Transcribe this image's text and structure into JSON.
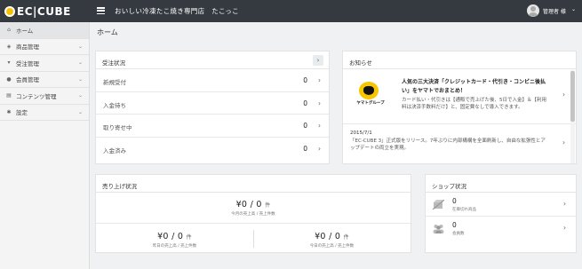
{
  "header": {
    "logo_text": "EC|CUBE",
    "shop_name": "おいしい冷凍たこ焼き専門店　たこっこ",
    "user_name": "管理者 様",
    "user_chevron": "⌄"
  },
  "sidebar": {
    "items": [
      {
        "label": "ホーム",
        "icon": "home-icon",
        "glyph": "⌂",
        "chevron": ""
      },
      {
        "label": "商品管理",
        "icon": "tag-icon",
        "glyph": "◈",
        "chevron": "⌄"
      },
      {
        "label": "受注管理",
        "icon": "cart-icon",
        "glyph": "▾",
        "chevron": "⌄"
      },
      {
        "label": "会員管理",
        "icon": "user-icon",
        "glyph": "●",
        "chevron": "⌄"
      },
      {
        "label": "コンテンツ管理",
        "icon": "file-icon",
        "glyph": "▤",
        "chevron": "⌄"
      },
      {
        "label": "設定",
        "icon": "gear-icon",
        "glyph": "✱",
        "chevron": "⌄"
      }
    ]
  },
  "page_title": "ホーム",
  "orders": {
    "title": "受注状況",
    "title_button": "›",
    "rows": [
      {
        "label": "新規受付",
        "count": "0",
        "chevron": "›"
      },
      {
        "label": "入金待ち",
        "count": "0",
        "chevron": "›"
      },
      {
        "label": "取り寄せ中",
        "count": "0",
        "chevron": "›"
      },
      {
        "label": "入金済み",
        "count": "0",
        "chevron": "›"
      }
    ]
  },
  "news": {
    "title": "お知らせ",
    "items": [
      {
        "logo_brand": "ヤマトグループ",
        "title": "人気の三大決済「クレジットカード・代引き・コンビニ後払い」をヤマトでおまとめ！",
        "body": "カード払い・代引きは【通販で売上げた後、5日で入金】＆【利用料は決済手数料だけ】と、固定費なしで導入できます。",
        "chevron": "›"
      },
      {
        "date": "2015/7/1",
        "body": "「EC-CUBE 3」正式版をリリース。7年ぶりに内部構構を全面刷新し、自由な拡張性とアップデートの両立を実現。",
        "chevron": "›"
      }
    ]
  },
  "sales": {
    "title": "売り上げ状況",
    "month": {
      "amount": "¥0 / 0",
      "unit": "件",
      "label": "今月の売上高 / 売上件数"
    },
    "yesterday": {
      "amount": "¥0 / 0",
      "unit": "件",
      "label": "昨日の売上高 / 売上件数"
    },
    "today": {
      "amount": "¥0 / 0",
      "unit": "件",
      "label": "今日の売上高 / 売上件数"
    }
  },
  "shop_status": {
    "title": "ショップ状況",
    "rows": [
      {
        "count": "0",
        "label": "在庫切れ商品",
        "icon": "out-of-stock-icon",
        "chevron": "›"
      },
      {
        "count": "0",
        "label": "会員数",
        "icon": "members-icon",
        "chevron": "›"
      }
    ]
  }
}
